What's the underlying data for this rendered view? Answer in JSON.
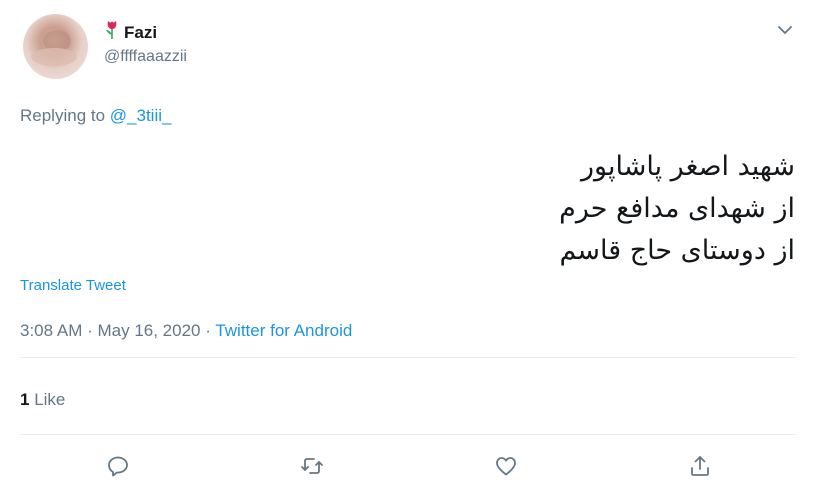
{
  "user": {
    "display_name": "Fazi",
    "handle": "@ffffaaazzii"
  },
  "reply": {
    "prefix": "Replying to",
    "to_handle": "@_3tiii_"
  },
  "tweet": {
    "lines": [
      "شهید اصغر پاشاپور",
      "از شهدای مدافع حرم",
      "از دوستای حاج قاسم"
    ]
  },
  "translate_label": "Translate Tweet",
  "meta": {
    "time": "3:08 AM",
    "sep1": " · ",
    "date": "May 16, 2020",
    "sep2": " · ",
    "source": "Twitter for Android"
  },
  "stats": {
    "like_count": "1",
    "like_label": "Like"
  },
  "actions": {
    "reply_icon": "reply-icon",
    "retweet_icon": "retweet-icon",
    "like_icon": "heart-icon",
    "share_icon": "share-icon"
  },
  "colors": {
    "link": "#1b95e0",
    "muted": "#657786",
    "text": "#14171a",
    "divider": "#e6ecf0"
  }
}
